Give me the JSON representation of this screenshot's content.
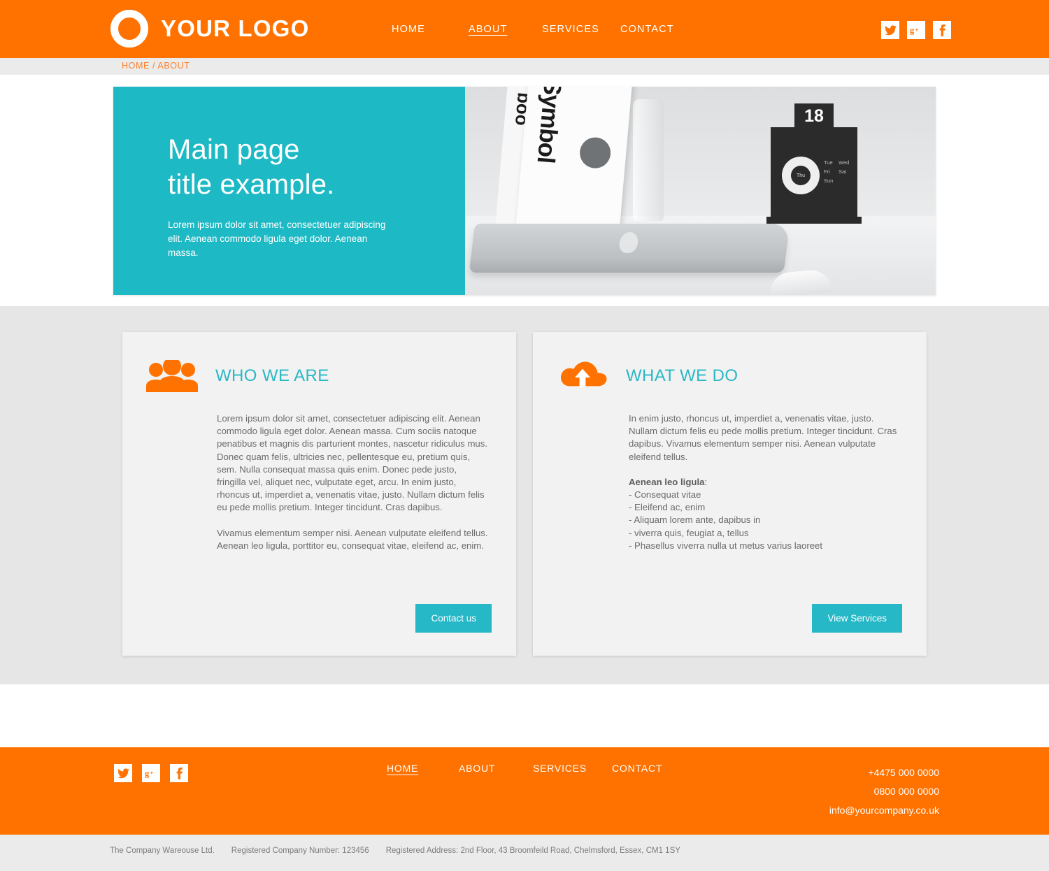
{
  "brand": {
    "logo_text": "YOUR LOGO",
    "orange": "#ff7200",
    "teal": "#1db9c4",
    "gray_section": "#e6e6e6"
  },
  "header": {
    "nav": [
      {
        "label": "HOME",
        "active": false
      },
      {
        "label": "ABOUT",
        "active": true
      },
      {
        "label": "SERVICES",
        "active": false
      },
      {
        "label": "CONTACT",
        "active": false
      }
    ],
    "social": [
      {
        "name": "twitter-icon",
        "label": "Twitter"
      },
      {
        "name": "google-plus-icon",
        "label": "Google Plus"
      },
      {
        "name": "facebook-icon",
        "label": "Facebook"
      }
    ]
  },
  "breadcrumb": {
    "text": "HOME / ABOUT"
  },
  "hero": {
    "title_line1": "Main page",
    "title_line2": "title example.",
    "subtitle": "Lorem ipsum dolor sit amet, consectetuer adipiscing elit. Aenean commodo ligula eget dolor. Aenean massa.",
    "photo": {
      "book_title": "Symbol",
      "book_title_small": "boo",
      "calendar_day_number": "18",
      "calendar_days": [
        "Tue",
        "Wed",
        "Thu",
        "Fri",
        "Sat",
        "Sun"
      ],
      "calendar_selected_day": "Thu"
    }
  },
  "cards": {
    "who_we_are": {
      "icon": "people-group-icon",
      "title": "WHO WE ARE",
      "paragraph1": "Lorem ipsum dolor sit amet, consectetuer adipiscing elit. Aenean commodo ligula eget dolor. Aenean massa. Cum sociis natoque penatibus et magnis dis parturient montes, nascetur ridiculus mus.",
      "paragraph2": "Donec quam felis, ultricies nec, pellentesque eu, pretium quis, sem. Nulla consequat massa quis enim. Donec pede justo, fringilla vel, aliquet nec, vulputate eget, arcu. In enim justo, rhoncus ut, imperdiet a, venenatis vitae, justo. Nullam dictum felis eu pede mollis pretium. Integer tincidunt. Cras dapibus.",
      "paragraph3": " Vivamus elementum semper nisi. Aenean vulputate eleifend tellus. Aenean leo ligula, porttitor eu, consequat vitae, eleifend ac, enim.",
      "button_label": "Contact us"
    },
    "what_we_do": {
      "icon": "cloud-upload-icon",
      "title": "WHAT WE DO",
      "paragraph1": "In enim justo, rhoncus ut, imperdiet a, venenatis vitae, justo. Nullam dictum felis eu pede mollis pretium. Integer tincidunt. Cras dapibus. Vivamus elementum semper nisi. Aenean vulputate eleifend tellus.",
      "list_heading": "Aenean leo ligula",
      "list_heading_suffix": ":",
      "list_items": [
        "- Consequat vitae",
        "- Eleifend ac, enim",
        "- Aliquam lorem ante, dapibus in",
        "- viverra quis, feugiat a, tellus",
        "- Phasellus viverra nulla ut metus varius laoreet"
      ],
      "button_label": "View Services"
    }
  },
  "footer": {
    "social": [
      {
        "name": "twitter-icon",
        "label": "Twitter"
      },
      {
        "name": "google-plus-icon",
        "label": "Google Plus"
      },
      {
        "name": "facebook-icon",
        "label": "Facebook"
      }
    ],
    "nav": [
      {
        "label": "HOME",
        "active": true
      },
      {
        "label": "ABOUT",
        "active": false
      },
      {
        "label": "SERVICES",
        "active": false
      },
      {
        "label": "CONTACT",
        "active": false
      }
    ],
    "phone_primary": "+4475 000 0000",
    "phone_secondary": "0800 000 0000",
    "email": "info@yourcompany.co.uk"
  },
  "legal": {
    "company": "The Company Wareouse Ltd.",
    "company_number": "Registered Company Number: 123456",
    "address": "Registered Address: 2nd Floor, 43 Broomfeild Road, Chelmsford, Essex, CM1 1SY"
  }
}
